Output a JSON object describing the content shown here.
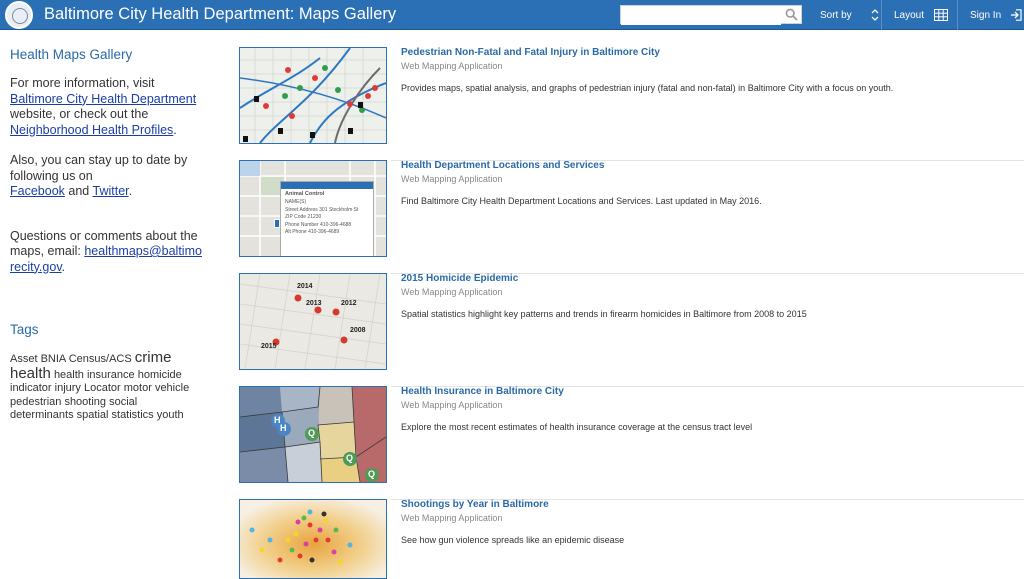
{
  "header": {
    "title": "Baltimore City Health Department: Maps Gallery",
    "search_placeholder": "",
    "sort_label": "Sort by",
    "layout_label": "Layout",
    "signin_label": "Sign In"
  },
  "sidebar": {
    "heading": "Health Maps Gallery",
    "info_text_1": "For more information, visit",
    "info_link_1": "Baltimore City Health Department",
    "info_text_2": "website, or check out the",
    "info_link_2": "Neighborhood Health Profiles",
    "info_text_3": ".",
    "social_text_1": "Also, you can stay up to date by following us on",
    "social_link_facebook": "Facebook",
    "social_text_2": "and",
    "social_link_twitter": "Twitter",
    "social_text_3": ".",
    "contact_text_1": "Questions or comments about the maps, email:",
    "contact_email": "healthmaps@baltimorecity.gov",
    "contact_text_2": ".",
    "tags_heading": "Tags",
    "tags": [
      "Asset",
      "BNIA",
      "Census/ACS",
      "crime",
      "health",
      "health insurance",
      "homicide",
      "indicator",
      "injury",
      "Locator",
      "motor vehicle",
      "pedestrian",
      "shooting",
      "social",
      "determinants",
      "spatial statistics",
      "youth"
    ]
  },
  "items": [
    {
      "title": "Pedestrian Non-Fatal and Fatal Injury in Baltimore City",
      "type": "Web Mapping Application",
      "description": "Provides maps, spatial analysis, and graphs of pedestrian injury (fatal and non-fatal) in Baltimore City with a focus on youth."
    },
    {
      "title": "Health Department Locations and Services",
      "type": "Web Mapping Application",
      "description": "Find Baltimore City Health Department Locations and Services. Last updated in May 2016."
    },
    {
      "title": "2015 Homicide Epidemic",
      "type": "Web Mapping Application",
      "description": "Spatial statistics highlight key patterns and trends in firearm homicides in Baltimore from 2008 to 2015"
    },
    {
      "title": "Health Insurance in Baltimore City",
      "type": "Web Mapping Application",
      "description": "Explore the most recent estimates of health insurance coverage at the census tract level"
    },
    {
      "title": "Shootings by Year in Baltimore",
      "type": "Web Mapping Application",
      "description": "See how gun violence spreads like an epidemic disease"
    }
  ],
  "thumb2_popup": {
    "title": "Animal Control",
    "name_label": "NAME(S)",
    "street_label": "Street Address",
    "street_value": "301 Stockholm St",
    "zip_label": "ZIP Code",
    "zip_value": "21230",
    "phone_label": "Phone Number",
    "phone_value": "410-396-4688",
    "alt_phone_label": "Alt Phone",
    "alt_phone_value": "410-396-4689"
  },
  "thumb3_labels": [
    "2014",
    "2013",
    "2012",
    "2008",
    "2015"
  ],
  "thumb4_labels": [
    "H",
    "H",
    "Q",
    "Q",
    "Q"
  ],
  "colors": {
    "header_bg": "#2b6fb4",
    "link": "#1a3ea6",
    "title": "#2a6aa8"
  }
}
